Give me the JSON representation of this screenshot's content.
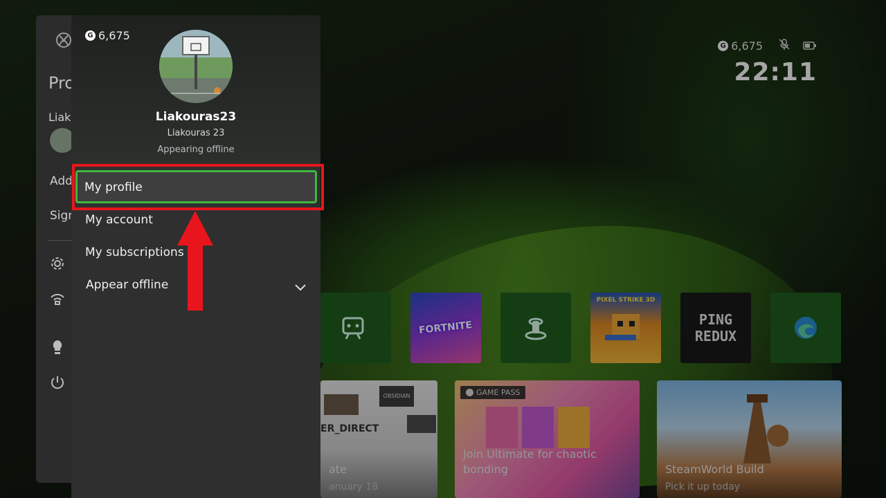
{
  "status": {
    "gamerscore": "6,675",
    "time": "22:11",
    "gamerscore_icon": "g-icon",
    "mic_icon": "mic-muted-icon",
    "battery_icon": "battery-icon"
  },
  "guide": {
    "title_partial": "Pro",
    "user_partial": "Liak",
    "add_partial": "Add",
    "sign_partial": "Sign"
  },
  "profile": {
    "gamerscore": "6,675",
    "gamertag": "Liakouras23",
    "real_name": "Liakouras 23",
    "presence": "Appearing offline"
  },
  "menu": {
    "my_profile": "My profile",
    "my_account": "My account",
    "my_subscriptions": "My subscriptions",
    "appear_offline": "Appear offline"
  },
  "tiles": {
    "fortnite": "FORTNITE",
    "pixel_strike": "PIXEL STRIKE 3D",
    "ping_redux_1": "PING",
    "ping_redux_2": "REDUX"
  },
  "cards": {
    "card1_thumb": "OBSIDIAN",
    "card1_banner": "ER_DIRECT",
    "card1_title": "ate",
    "card1_sub": "anuary 18",
    "gamepass_badge": "GAME PASS",
    "card2_title_1": "Join Ultimate for chaotic",
    "card2_title_2": "bonding",
    "card3_title": "SteamWorld Build",
    "card3_sub": "Pick it up today"
  },
  "colors": {
    "highlight": "#e8161c",
    "focus": "#3fb63f",
    "panel": "#2f2f2f"
  }
}
